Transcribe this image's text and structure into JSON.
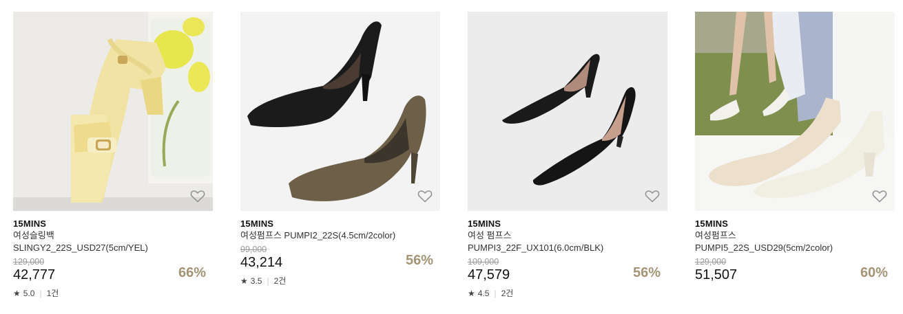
{
  "colors": {
    "discount": "#a39576",
    "original_price": "#9a9a9a",
    "image_bg_gray": "#eeedec"
  },
  "products": [
    {
      "brand": "15MINS",
      "name_line1": "여성슬링백",
      "name_line2": "SLINGY2_22S_USD27(5cm/YEL)",
      "original_price": "129,000",
      "price": "42,777",
      "discount": "66%",
      "rating": "5.0",
      "reviews": "1건",
      "icon": "heart-outline-icon"
    },
    {
      "brand": "15MINS",
      "name_line1": "여성펌프스 PUMPI2_22S(4.5cm/2color)",
      "original_price": "99,000",
      "price": "43,214",
      "discount": "56%",
      "rating": "3.5",
      "reviews": "2건",
      "icon": "heart-outline-icon"
    },
    {
      "brand": "15MINS",
      "name_line1": "여성 펌프스",
      "name_line2": "PUMPI3_22F_UX101(6.0cm/BLK)",
      "original_price": "109,000",
      "price": "47,579",
      "discount": "56%",
      "rating": "4.5",
      "reviews": "2건",
      "icon": "heart-outline-icon"
    },
    {
      "brand": "15MINS",
      "name_line1": "여성펌프스",
      "name_line2": "PUMPI5_22S_USD29(5cm/2color)",
      "original_price": "129,000",
      "price": "51,507",
      "discount": "60%",
      "icon": "heart-outline-icon"
    }
  ]
}
